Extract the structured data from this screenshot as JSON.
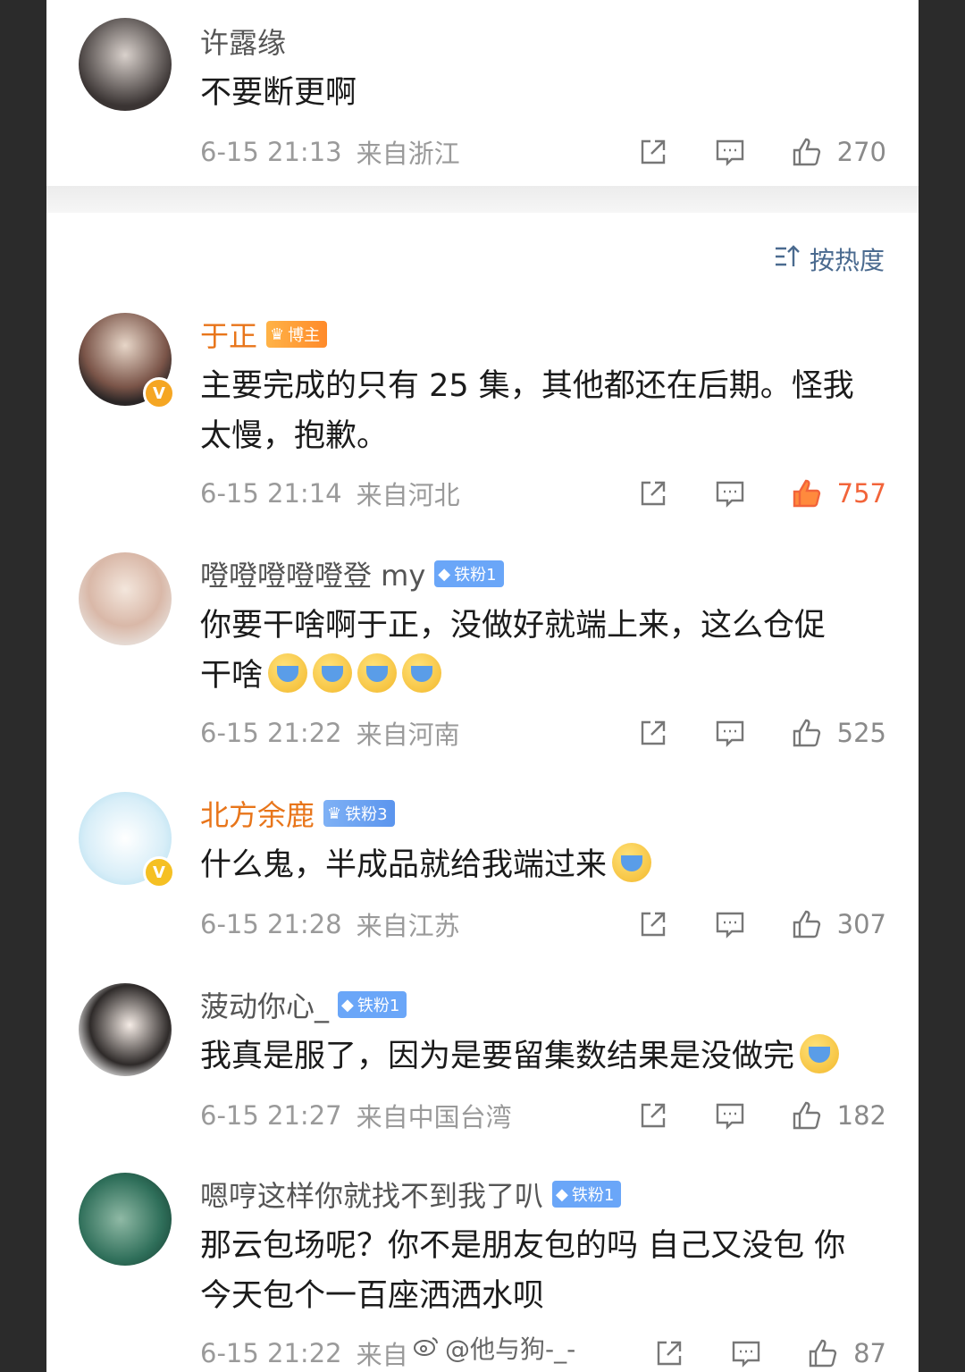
{
  "sort": {
    "label": "按热度"
  },
  "comments": [
    {
      "name": "许露缘",
      "text1": "不要断更啊",
      "time": "6-15 21:13",
      "location": "来自浙江",
      "likes": "270"
    },
    {
      "name": "于正",
      "badge": "博主",
      "text1": "主要完成的只有 25 集，其他都还在后期。怪我",
      "text2": "太慢，抱歉。",
      "time": "6-15 21:14",
      "location": "来自河北",
      "likes": "757"
    },
    {
      "name": "噔噔噔噔噔登 my",
      "badge": "铁粉1",
      "text1": "你要干啥啊于正，没做好就端上来，这么仓促",
      "text2": "干啥",
      "time": "6-15 21:22",
      "location": "来自河南",
      "likes": "525"
    },
    {
      "name": "北方余鹿",
      "badge": "铁粉3",
      "text1": "什么鬼，半成品就给我端过来",
      "time": "6-15 21:28",
      "location": "来自江苏",
      "likes": "307"
    },
    {
      "name": "菠动你心_",
      "badge": "铁粉1",
      "text1": "我真是服了，因为是要留集数结果是没做完",
      "time": "6-15 21:27",
      "location": "来自中国台湾",
      "likes": "182"
    },
    {
      "name": "嗯哼这样你就找不到我了叭",
      "badge": "铁粉1",
      "text1": "那云包场呢？你不是朋友包的吗 自己又没包 你",
      "text2": "今天包个一百座洒洒水呗",
      "time": "6-15 21:22",
      "location": "来自",
      "likes": "87"
    }
  ],
  "watermark": "@他与狗-_-",
  "colors": {
    "accent": "#e8751a",
    "like_active": "#f2643a",
    "fan_badge": "#6aa6f8"
  }
}
